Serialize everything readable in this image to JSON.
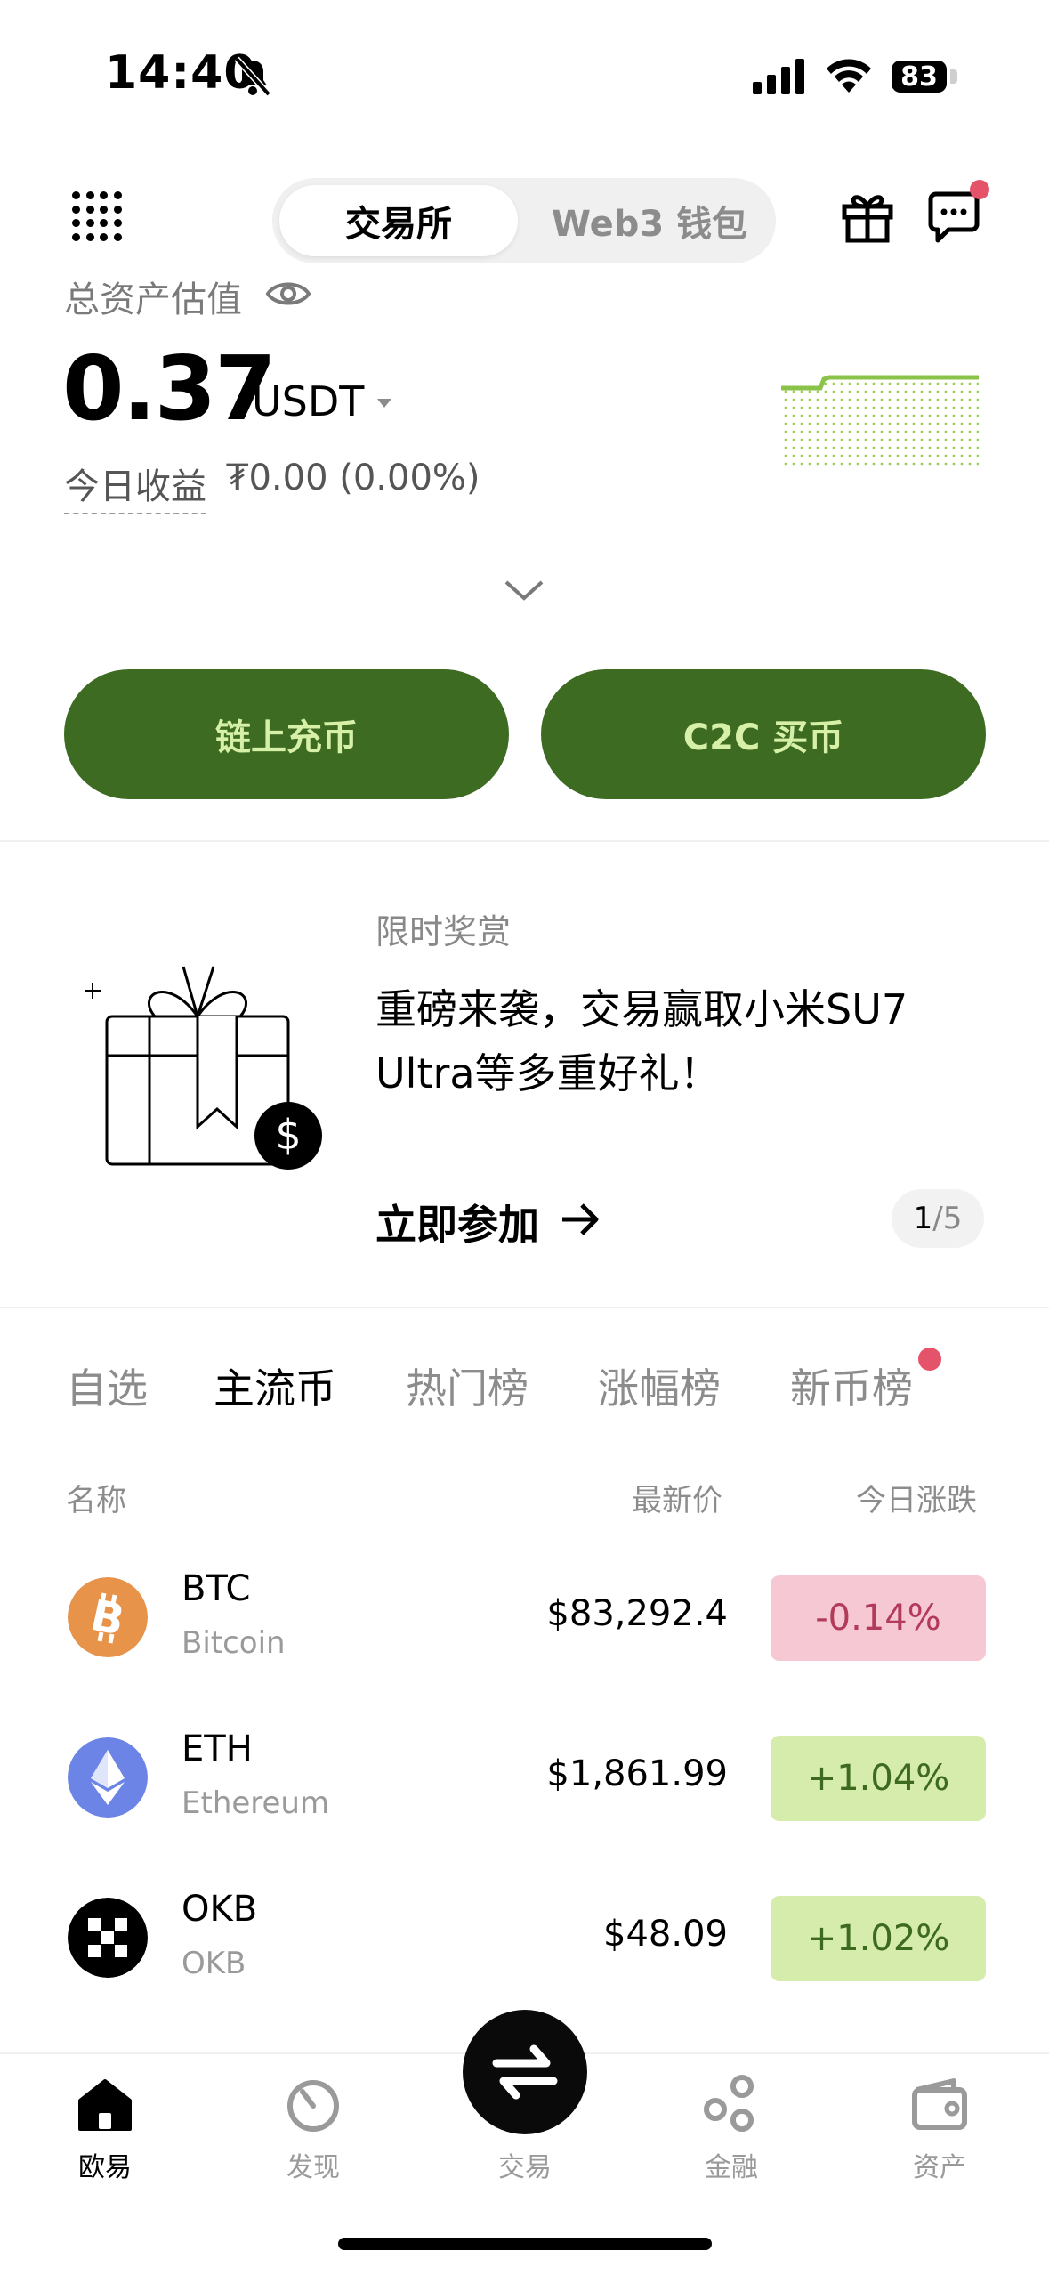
{
  "status_bar": {
    "time": "14:40",
    "battery": "83"
  },
  "header": {
    "segments": [
      {
        "label": "交易所",
        "active": true
      },
      {
        "label": "Web3 钱包",
        "active": false
      }
    ]
  },
  "assets": {
    "label": "总资产估值",
    "value": "0.37",
    "unit": "USDT",
    "today_label": "今日收益",
    "today_value": "₮0.00 (0.00%)"
  },
  "actions": {
    "deposit_label": "链上充币",
    "c2c_label": "C2C 买币"
  },
  "promo": {
    "tag": "限时奖赏",
    "title": "重磅来袭，交易赢取小米SU7 Ultra等多重好礼！",
    "cta": "立即参加",
    "pager_current": "1",
    "pager_total": "/5"
  },
  "market": {
    "tabs": [
      {
        "label": "自选",
        "active": false
      },
      {
        "label": "主流币",
        "active": true
      },
      {
        "label": "热门榜",
        "active": false
      },
      {
        "label": "涨幅榜",
        "active": false
      },
      {
        "label": "新币榜",
        "active": false
      }
    ],
    "columns": {
      "name": "名称",
      "price": "最新价",
      "change": "今日涨跌"
    },
    "rows": [
      {
        "symbol": "BTC",
        "name": "Bitcoin",
        "price": "$83,292.4",
        "change": "-0.14%",
        "direction": "down",
        "icon": "btc-icon",
        "color": "#e8934a"
      },
      {
        "symbol": "ETH",
        "name": "Ethereum",
        "price": "$1,861.99",
        "change": "+1.04%",
        "direction": "up",
        "icon": "eth-icon",
        "color": "#6b84e6"
      },
      {
        "symbol": "OKB",
        "name": "OKB",
        "price": "$48.09",
        "change": "+1.02%",
        "direction": "up",
        "icon": "okb-icon",
        "color": "#000000"
      }
    ]
  },
  "bottom_nav": {
    "items": [
      {
        "label": "欧易",
        "active": true,
        "icon": "home-icon"
      },
      {
        "label": "发现",
        "active": false,
        "icon": "discover-icon"
      },
      {
        "label": "交易",
        "active": false,
        "icon": "swap-icon"
      },
      {
        "label": "金融",
        "active": false,
        "icon": "finance-icon"
      },
      {
        "label": "资产",
        "active": false,
        "icon": "wallet-icon"
      }
    ]
  },
  "colors": {
    "brand_green": "#3e6b22",
    "button_text": "#d7f0a8",
    "down_bg": "#f6c8d4",
    "down_text": "#b23a5a",
    "up_bg": "#d6ecad",
    "up_text": "#3d6a1e",
    "alert_dot": "#e5536b"
  }
}
